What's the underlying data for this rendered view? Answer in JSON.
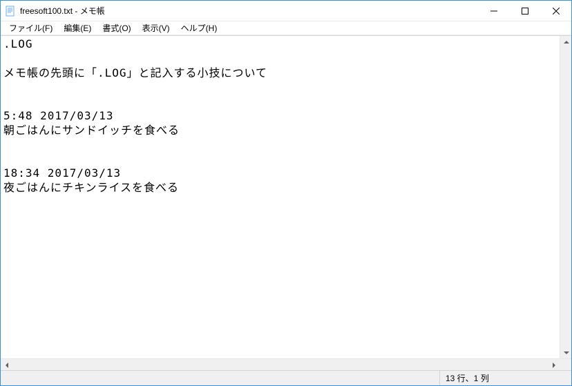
{
  "window": {
    "title": "freesoft100.txt - メモ帳"
  },
  "menu": {
    "file": "ファイル(F)",
    "edit": "編集(E)",
    "format": "書式(O)",
    "view": "表示(V)",
    "help": "ヘルプ(H)"
  },
  "content": {
    "text": ".LOG\n\nメモ帳の先頭に「.LOG」と記入する小技について\n\n\n5:48 2017/03/13\n朝ごはんにサンドイッチを食べる\n\n\n18:34 2017/03/13\n夜ごはんにチキンライスを食べる\n"
  },
  "statusbar": {
    "position": "13 行、1 列"
  }
}
